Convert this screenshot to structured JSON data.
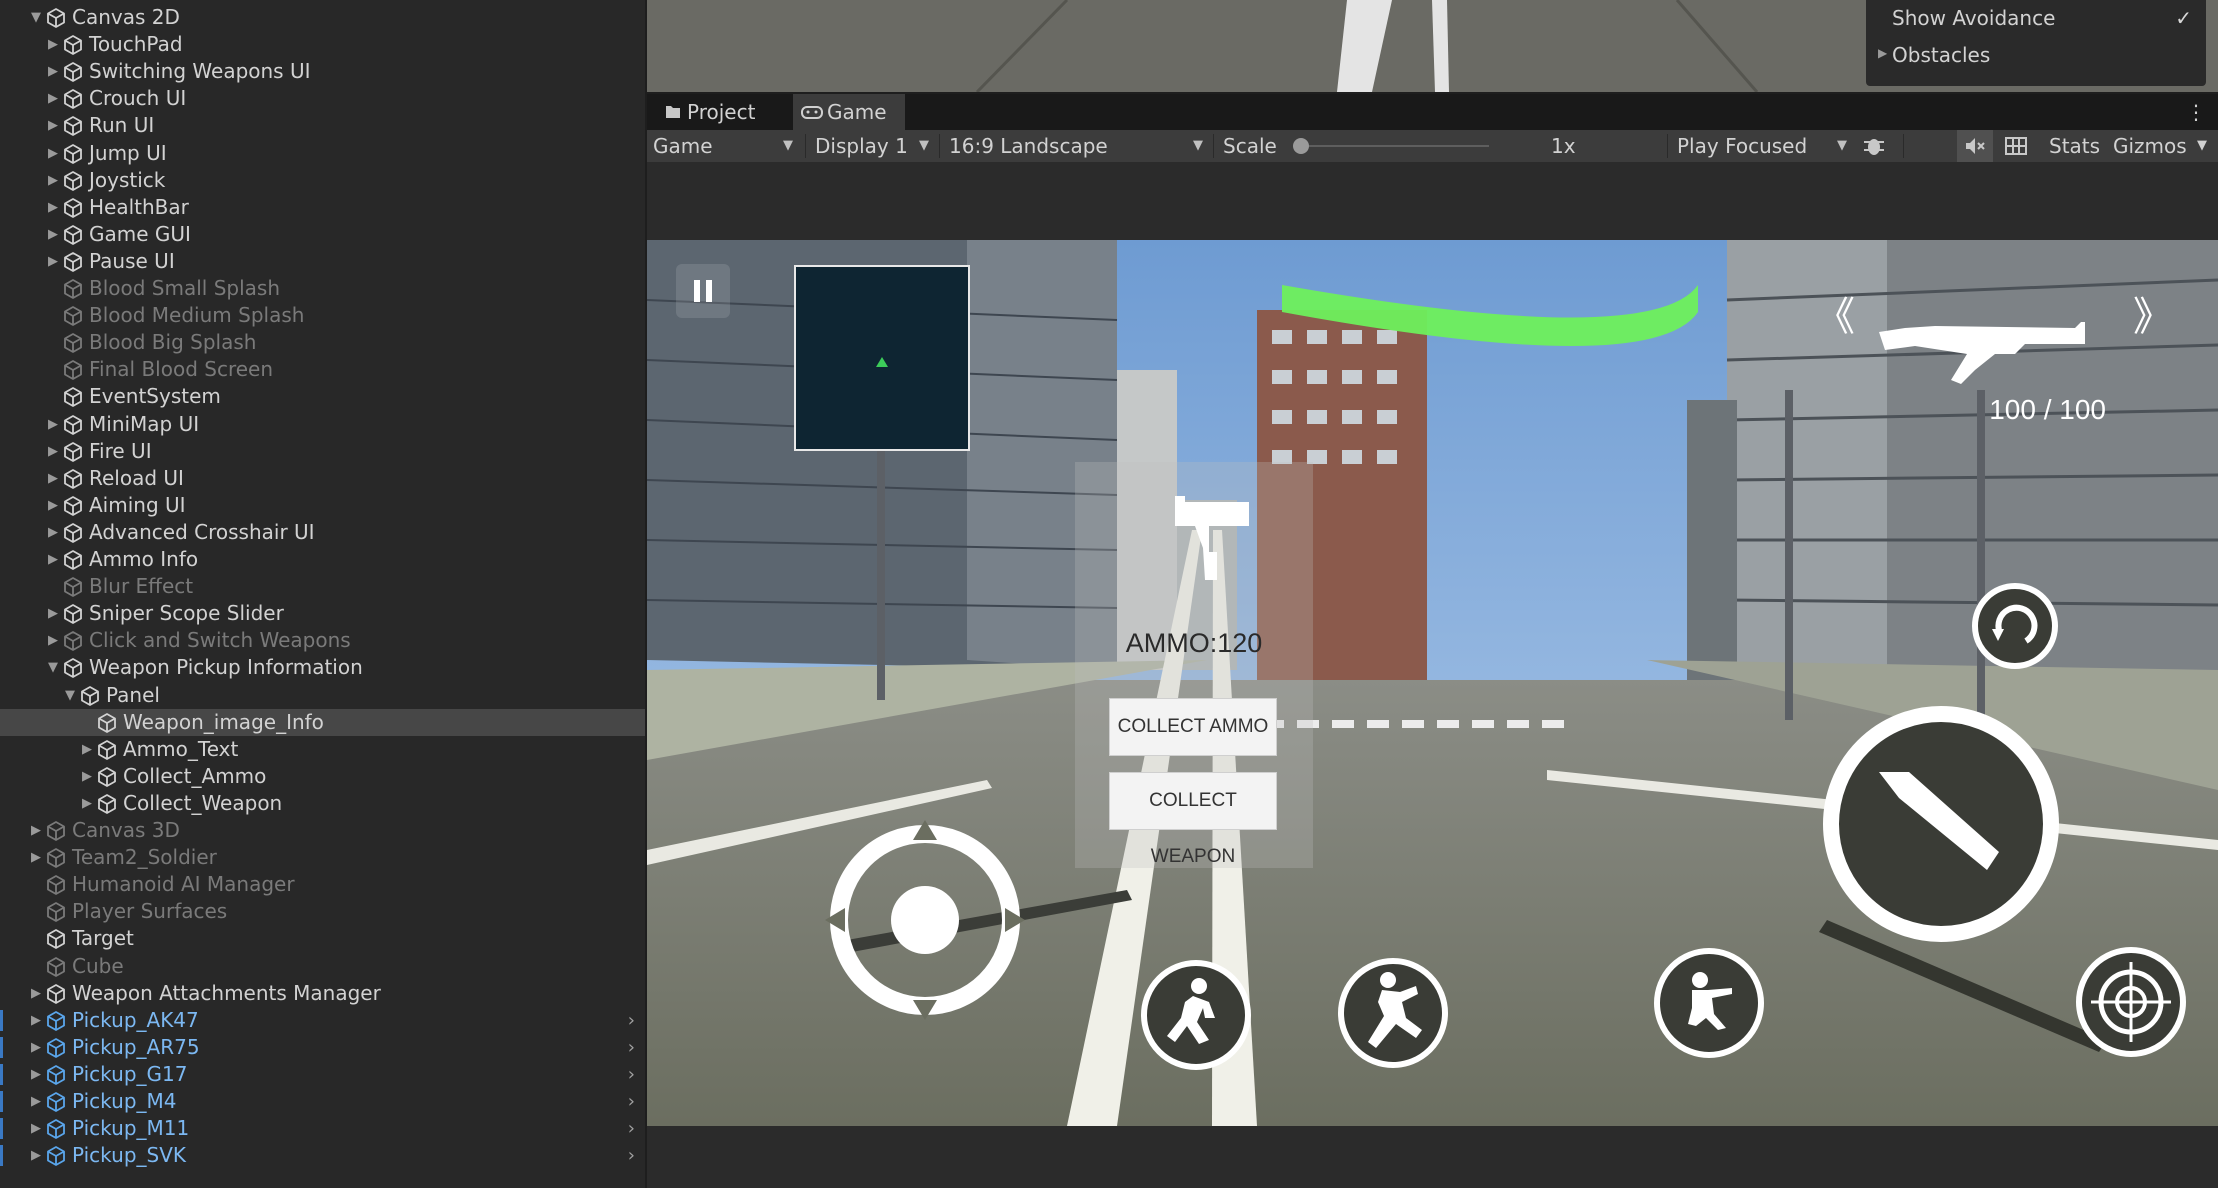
{
  "hierarchy": {
    "items": [
      {
        "label": "Canvas 2D",
        "depth": 1,
        "arrow": "open",
        "state": "normal"
      },
      {
        "label": "TouchPad",
        "depth": 2,
        "arrow": "closed",
        "state": "normal"
      },
      {
        "label": "Switching Weapons UI",
        "depth": 2,
        "arrow": "closed",
        "state": "normal"
      },
      {
        "label": "Crouch UI",
        "depth": 2,
        "arrow": "closed",
        "state": "normal"
      },
      {
        "label": "Run UI",
        "depth": 2,
        "arrow": "closed",
        "state": "normal"
      },
      {
        "label": "Jump UI",
        "depth": 2,
        "arrow": "closed",
        "state": "normal"
      },
      {
        "label": "Joystick",
        "depth": 2,
        "arrow": "closed",
        "state": "normal"
      },
      {
        "label": "HealthBar",
        "depth": 2,
        "arrow": "closed",
        "state": "normal"
      },
      {
        "label": "Game GUI",
        "depth": 2,
        "arrow": "closed",
        "state": "normal"
      },
      {
        "label": "Pause UI",
        "depth": 2,
        "arrow": "closed",
        "state": "normal"
      },
      {
        "label": "Blood Small Splash",
        "depth": 2,
        "arrow": "none",
        "state": "dim"
      },
      {
        "label": "Blood Medium Splash",
        "depth": 2,
        "arrow": "none",
        "state": "dim"
      },
      {
        "label": "Blood Big Splash",
        "depth": 2,
        "arrow": "none",
        "state": "dim"
      },
      {
        "label": "Final Blood Screen",
        "depth": 2,
        "arrow": "none",
        "state": "dim"
      },
      {
        "label": "EventSystem",
        "depth": 2,
        "arrow": "none",
        "state": "normal"
      },
      {
        "label": "MiniMap UI",
        "depth": 2,
        "arrow": "closed",
        "state": "normal"
      },
      {
        "label": "Fire UI",
        "depth": 2,
        "arrow": "closed",
        "state": "normal"
      },
      {
        "label": "Reload UI",
        "depth": 2,
        "arrow": "closed",
        "state": "normal"
      },
      {
        "label": "Aiming UI",
        "depth": 2,
        "arrow": "closed",
        "state": "normal"
      },
      {
        "label": "Advanced Crosshair UI",
        "depth": 2,
        "arrow": "closed",
        "state": "normal"
      },
      {
        "label": "Ammo Info",
        "depth": 2,
        "arrow": "closed",
        "state": "normal"
      },
      {
        "label": "Blur Effect",
        "depth": 2,
        "arrow": "none",
        "state": "dim"
      },
      {
        "label": "Sniper Scope Slider",
        "depth": 2,
        "arrow": "closed",
        "state": "normal"
      },
      {
        "label": "Click and Switch Weapons",
        "depth": 2,
        "arrow": "closed",
        "state": "dim"
      },
      {
        "label": "Weapon Pickup Information",
        "depth": 2,
        "arrow": "open",
        "state": "normal"
      },
      {
        "label": "Panel",
        "depth": 3,
        "arrow": "open",
        "state": "normal"
      },
      {
        "label": "Weapon_image_Info",
        "depth": 4,
        "arrow": "none",
        "state": "selected"
      },
      {
        "label": "Ammo_Text",
        "depth": 4,
        "arrow": "closed",
        "state": "normal"
      },
      {
        "label": "Collect_Ammo",
        "depth": 4,
        "arrow": "closed",
        "state": "normal"
      },
      {
        "label": "Collect_Weapon",
        "depth": 4,
        "arrow": "closed",
        "state": "normal"
      },
      {
        "label": "Canvas 3D",
        "depth": 1,
        "arrow": "closed",
        "state": "dim"
      },
      {
        "label": "Team2_Soldier",
        "depth": 1,
        "arrow": "closed",
        "state": "dim"
      },
      {
        "label": "Humanoid AI Manager",
        "depth": 1,
        "arrow": "none",
        "state": "dim"
      },
      {
        "label": "Player Surfaces",
        "depth": 1,
        "arrow": "none",
        "state": "dim"
      },
      {
        "label": "Target",
        "depth": 1,
        "arrow": "none",
        "state": "normal"
      },
      {
        "label": "Cube",
        "depth": 1,
        "arrow": "none",
        "state": "dim"
      },
      {
        "label": "Weapon Attachments Manager",
        "depth": 1,
        "arrow": "closed",
        "state": "normal"
      },
      {
        "label": "Pickup_AK47",
        "depth": 1,
        "arrow": "closed",
        "state": "prefab"
      },
      {
        "label": "Pickup_AR75",
        "depth": 1,
        "arrow": "closed",
        "state": "prefab"
      },
      {
        "label": "Pickup_G17",
        "depth": 1,
        "arrow": "closed",
        "state": "prefab"
      },
      {
        "label": "Pickup_M4",
        "depth": 1,
        "arrow": "closed",
        "state": "prefab"
      },
      {
        "label": "Pickup_M11",
        "depth": 1,
        "arrow": "closed",
        "state": "prefab"
      },
      {
        "label": "Pickup_SVK",
        "depth": 1,
        "arrow": "closed",
        "state": "prefab"
      }
    ]
  },
  "scene_overlay": {
    "show_avoidance": "Show Avoidance",
    "obstacles": "Obstacles"
  },
  "tabs": {
    "project": "Project",
    "game": "Game"
  },
  "toolbar": {
    "view_mode": "Game",
    "display": "Display 1",
    "aspect": "16:9 Landscape",
    "scale_label": "Scale",
    "scale_value": "1x",
    "play_mode": "Play Focused",
    "stats": "Stats",
    "gizmos": "Gizmos"
  },
  "game_ui": {
    "ammo_text": "AMMO:120",
    "collect_ammo": "COLLECT AMMO",
    "collect_weapon": "COLLECT WEAPON",
    "weapon_counter": "100 / 100",
    "prev_weapon_glyph": "《",
    "next_weapon_glyph": "》"
  },
  "colors": {
    "health_bar": "#6ef05c",
    "prefab_text": "#7cb8f2",
    "panel_bg": "#282828"
  },
  "icons": [
    "cube-icon",
    "folder-icon",
    "gamepad-icon",
    "bug-icon",
    "mute-icon",
    "grid-icon",
    "pause-icon",
    "reload-icon",
    "fire-icon",
    "crouch-icon",
    "run-icon",
    "jump-icon",
    "aim-icon",
    "joystick-icon"
  ]
}
